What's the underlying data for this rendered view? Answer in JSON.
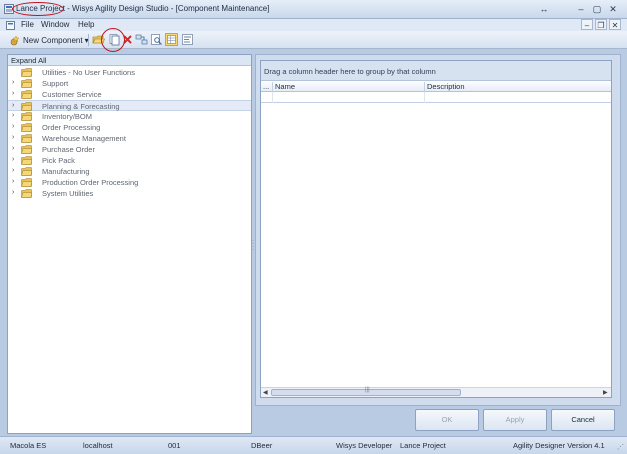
{
  "window": {
    "title_project": "Lance Project",
    "title_rest": " - Wisys Agility Design Studio - [Component Maintenance]",
    "restore_glyph": "↔",
    "minimize_glyph": "–",
    "maximize_glyph": "▢",
    "close_glyph": "✕"
  },
  "menu": {
    "items": [
      "File",
      "Window",
      "Help"
    ],
    "mdi_minimize": "–",
    "mdi_restore": "❐",
    "mdi_close": "✕"
  },
  "toolbar": {
    "new_component_label": "New Component",
    "dropdown_glyph": "▾",
    "icons": [
      "open-folder-icon",
      "copy-document-icon",
      "delete-icon",
      "connect-icon",
      "search-document-icon",
      "grid-view-icon",
      "properties-icon"
    ]
  },
  "tree": {
    "expand_all_label": "Expand All",
    "items": [
      {
        "label": "Utilities - No User Functions",
        "has_children": false,
        "selected": false
      },
      {
        "label": "Support",
        "has_children": true,
        "selected": false
      },
      {
        "label": "Customer Service",
        "has_children": true,
        "selected": false
      },
      {
        "label": "Planning & Forecasting",
        "has_children": true,
        "selected": true
      },
      {
        "label": "Inventory/BOM",
        "has_children": true,
        "selected": false
      },
      {
        "label": "Order Processing",
        "has_children": true,
        "selected": false
      },
      {
        "label": "Warehouse Management",
        "has_children": true,
        "selected": false
      },
      {
        "label": "Purchase Order",
        "has_children": true,
        "selected": false
      },
      {
        "label": "Pick Pack",
        "has_children": true,
        "selected": false
      },
      {
        "label": "Manufacturing",
        "has_children": true,
        "selected": false
      },
      {
        "label": "Production Order Processing",
        "has_children": true,
        "selected": false
      },
      {
        "label": "System Utilities",
        "has_children": true,
        "selected": false
      }
    ]
  },
  "grid": {
    "group_panel_text": "Drag a column header here to group by that column",
    "columns": [
      "...",
      "Name",
      "Description"
    ]
  },
  "buttons": {
    "ok": "OK",
    "apply": "Apply",
    "cancel": "Cancel"
  },
  "status": {
    "company": "Macola ES",
    "server": "localhost",
    "code": "001",
    "database": "DBeer",
    "role": "Wisys Developer",
    "project": "Lance Project",
    "version": "Agility Designer Version 4.1"
  },
  "colors": {
    "annotation_circle": "#c0161f",
    "selection_bg": "#e4ebf6",
    "chrome_blue": "#b9cbe2"
  }
}
